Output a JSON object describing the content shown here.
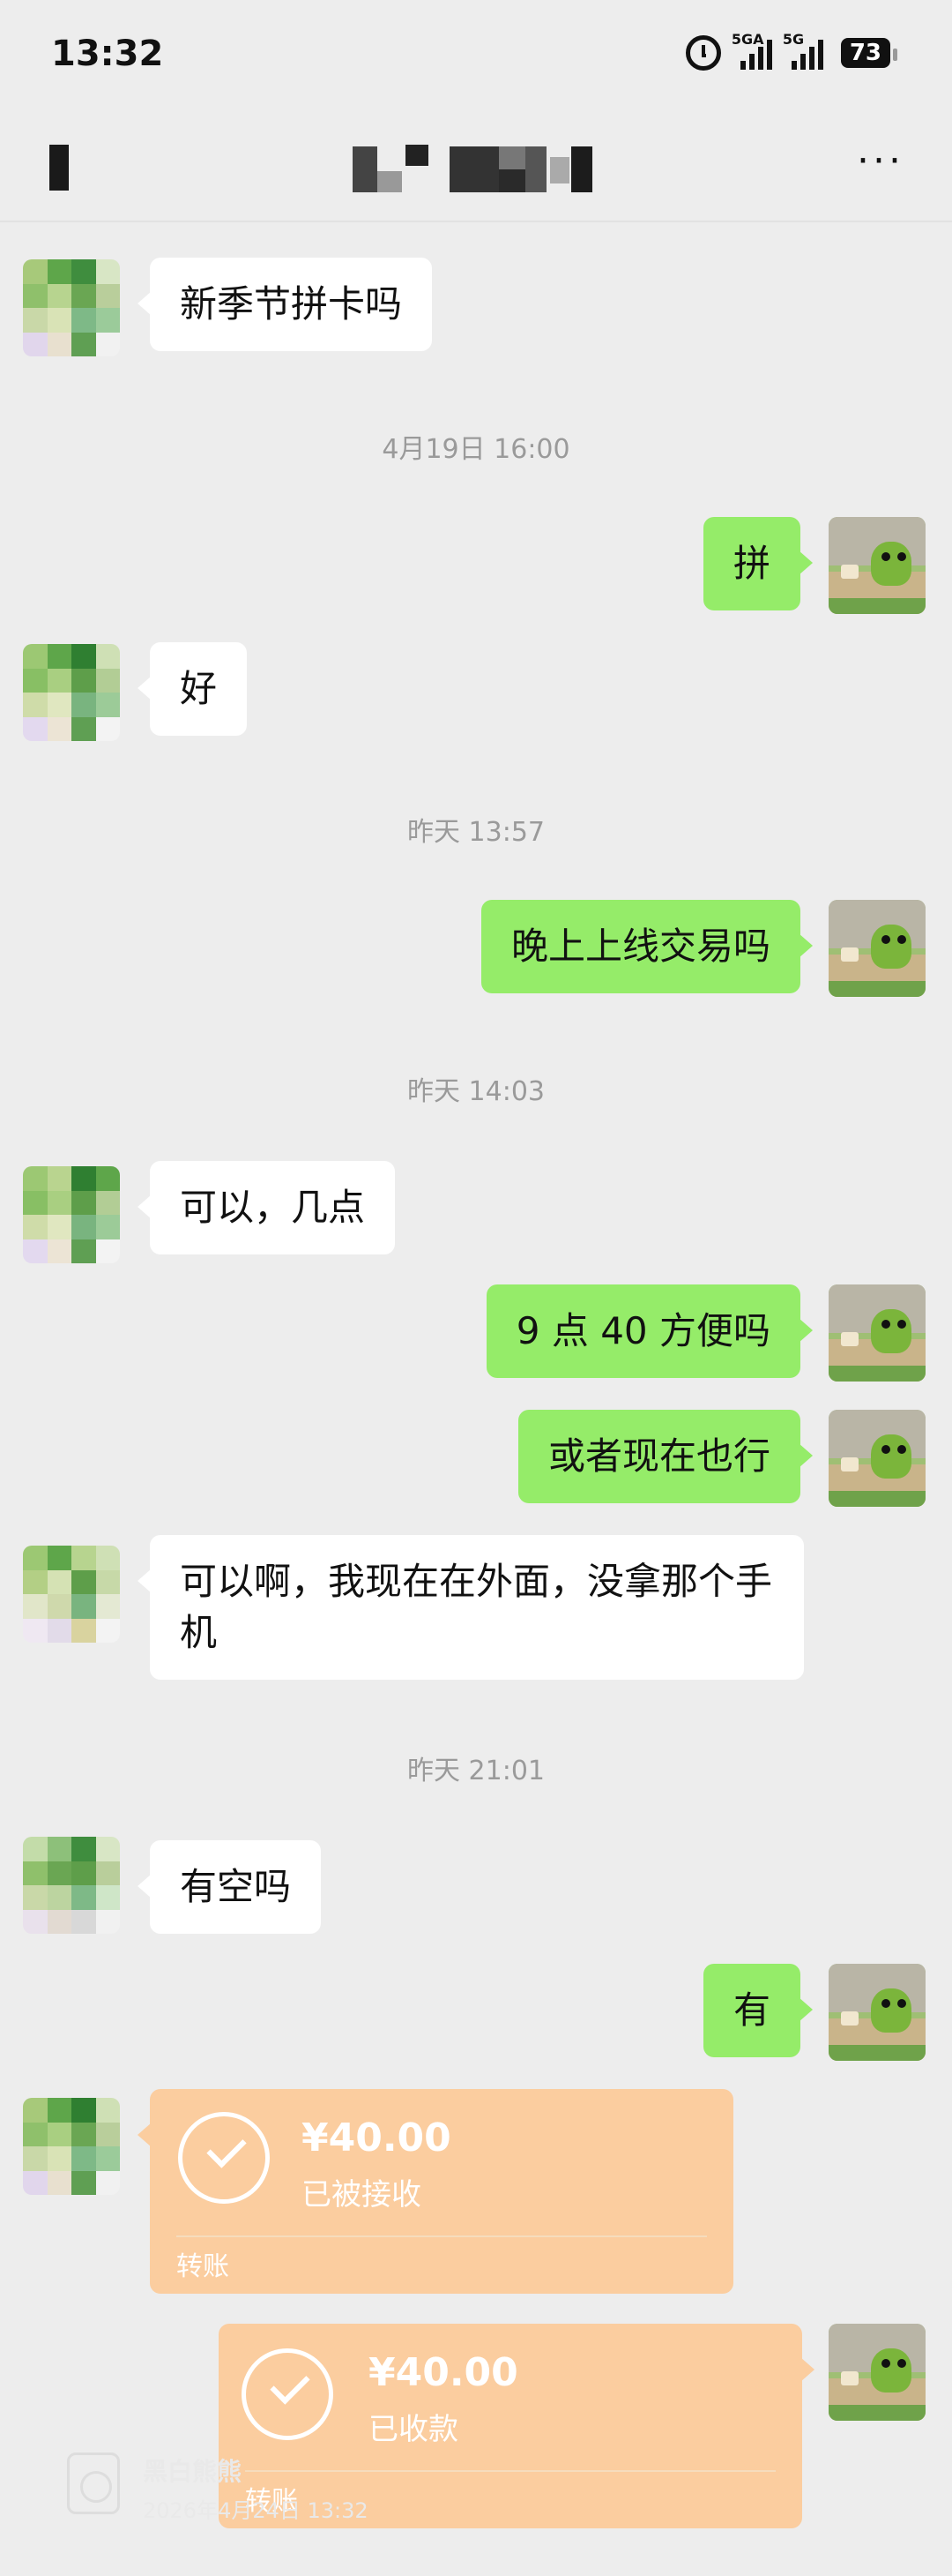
{
  "status_bar": {
    "time": "13:32",
    "net1": "5GA",
    "net2": "5G",
    "battery": "73",
    "icons": [
      "alarm-icon",
      "signal-icon",
      "signal-icon",
      "battery-icon"
    ]
  },
  "nav": {
    "back_icon": "back-icon",
    "more_label": "···"
  },
  "colors": {
    "background": "#ededed",
    "incoming_bubble": "#ffffff",
    "outgoing_bubble": "#95ec69",
    "transfer_card": "#fbcd9f",
    "timestamp": "#9a9a9a"
  },
  "messages": [
    {
      "dir": "in",
      "text": "新季节拼卡吗"
    },
    {
      "type": "time",
      "text": "4月19日 16:00"
    },
    {
      "dir": "out",
      "text": "拼"
    },
    {
      "dir": "in",
      "text": "好"
    },
    {
      "type": "time",
      "text": "昨天 13:57"
    },
    {
      "dir": "out",
      "text": "晚上上线交易吗"
    },
    {
      "type": "time",
      "text": "昨天 14:03"
    },
    {
      "dir": "in",
      "text": "可以，几点"
    },
    {
      "dir": "out",
      "text": "9 点 40 方便吗"
    },
    {
      "dir": "out",
      "text": "或者现在也行"
    },
    {
      "dir": "in",
      "text": "可以啊，我现在在外面，没拿那个手机"
    },
    {
      "type": "time",
      "text": "昨天 21:01"
    },
    {
      "dir": "in",
      "text": "有空吗"
    },
    {
      "dir": "out",
      "text": "有"
    }
  ],
  "transfers": [
    {
      "dir": "in",
      "amount": "¥40.00",
      "status": "已被接收",
      "label": "转账"
    },
    {
      "dir": "out",
      "amount": "¥40.00",
      "status": "已收款",
      "label": "转账"
    }
  ],
  "watermark": {
    "name": "黑白熊熊",
    "time": "2026年4月24日 13:32"
  }
}
